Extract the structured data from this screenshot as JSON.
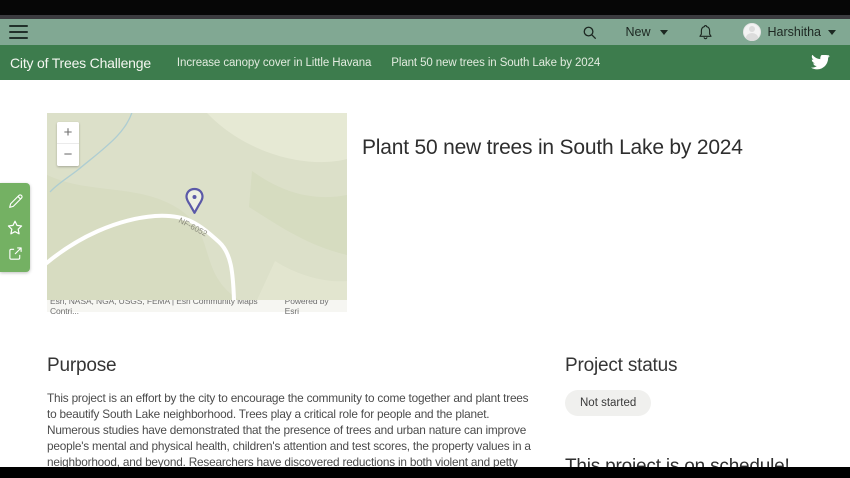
{
  "header": {
    "new_label": "New",
    "user_name": "Harshitha"
  },
  "nav": {
    "title": "City of Trees Challenge",
    "items": [
      {
        "label": "Increase canopy cover in Little Havana"
      },
      {
        "label": "Plant 50 new trees in South Lake by 2024"
      }
    ]
  },
  "map": {
    "zoom_in_label": "+",
    "zoom_out_label": "−",
    "road_label": "NF-6052",
    "attribution": "Esri, NASA, NGA, USGS, FEMA | Esri Community Maps Contri...",
    "powered_by": "Powered by Esri"
  },
  "content": {
    "title": "Plant 50 new trees in South Lake by 2024",
    "purpose_heading": "Purpose",
    "purpose_lines": [
      "This project is an effort by the city to encourage the community to come together and plant trees",
      "to beautify South Lake neighborhood. Trees play a critical role for people and the planet.",
      "Numerous studies have demonstrated that the presence of trees and urban nature can improve",
      "people's mental and physical health, children's attention and test scores, the property values in a",
      "neighborhood, and beyond. Researchers have discovered reductions in both violent and petty"
    ],
    "status_heading": "Project status",
    "status_badge": "Not started",
    "schedule_teaser": "This project is on schedule!"
  },
  "colors": {
    "appbar_bg": "#81a893",
    "nav_bg": "#3d7c4d",
    "tools_bg": "#74b163",
    "map_bg": "#dce0c9",
    "pin": "#5b59a8",
    "badge_bg": "#f0f0ee"
  }
}
